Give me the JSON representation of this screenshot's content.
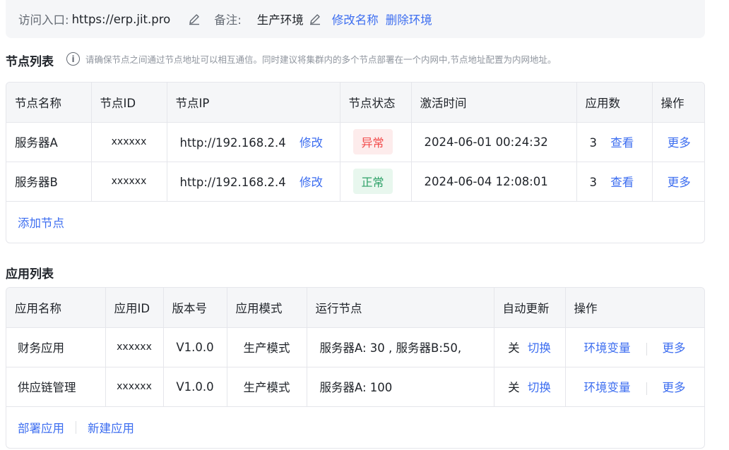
{
  "access": {
    "label": "访问入口:",
    "url": "https://erp.jit.pro",
    "note_label": "备注:",
    "note_value": "生产环境",
    "rename": "修改名称",
    "delete": "删除环境",
    "edit_icon": "pencil-icon"
  },
  "nodes": {
    "title": "节点列表",
    "info_icon": "ⓘ",
    "hint": "请确保节点之间通过节点地址可以相互通信。同时建议将集群内的多个节点部署在一个内网中,节点地址配置为内网地址。",
    "columns": [
      "节点名称",
      "节点ID",
      "节点IP",
      "节点状态",
      "激活时间",
      "应用数",
      "操作"
    ],
    "rows": [
      {
        "name": "服务器A",
        "id": "xxxxxx",
        "ip": "http://192.168.2.4",
        "edit": "修改",
        "status": "异常",
        "activated": "2024-06-01 00:24:32",
        "apps": "3",
        "view": "查看",
        "more": "更多"
      },
      {
        "name": "服务器B",
        "id": "xxxxxx",
        "ip": "http://192.168.2.4",
        "edit": "修改",
        "status": "正常",
        "activated": "2024-06-04 12:08:01",
        "apps": "3",
        "view": "查看",
        "more": "更多"
      }
    ],
    "add": "添加节点",
    "status_colors": {
      "error": "#f24c4c",
      "ok": "#2ea168"
    }
  },
  "apps": {
    "title": "应用列表",
    "columns": [
      "应用名称",
      "应用ID",
      "版本号",
      "应用模式",
      "运行节点",
      "自动更新",
      "操作"
    ],
    "rows": [
      {
        "name": "财务应用",
        "id": "xxxxxx",
        "version": "V1.0.0",
        "mode": "生产模式",
        "nodes": "服务器A:  30 , 服务器B:50,",
        "auto": "关",
        "toggle": "切换",
        "env": "环境变量",
        "more": "更多"
      },
      {
        "name": "供应链管理",
        "id": "xxxxxx",
        "version": "V1.0.0",
        "mode": "生产模式",
        "nodes": "服务器A:  100",
        "auto": "关",
        "toggle": "切换",
        "env": "环境变量",
        "more": "更多"
      }
    ],
    "deploy": "部署应用",
    "create": "新建应用"
  },
  "colors": {
    "accent": "#3d6ef0",
    "header_bg": "#f5f6f8",
    "border": "#e5e6eb"
  }
}
